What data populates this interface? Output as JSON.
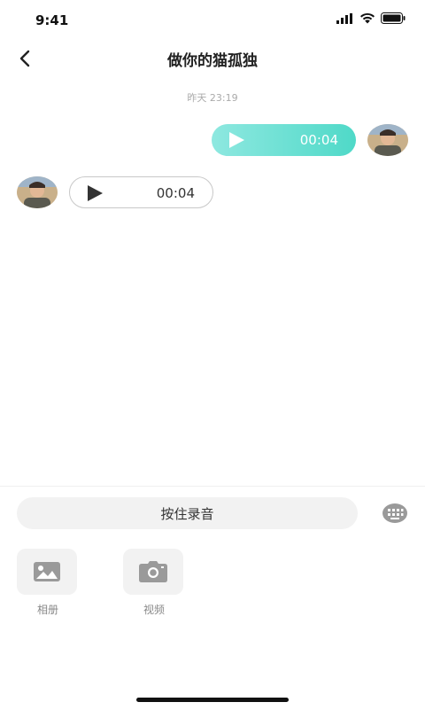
{
  "status_bar": {
    "time": "9:41"
  },
  "nav": {
    "title": "做你的猫孤独"
  },
  "chat": {
    "timestamp": "昨天 23:19",
    "messages": [
      {
        "direction": "outgoing",
        "type": "voice",
        "duration": "00:04"
      },
      {
        "direction": "incoming",
        "type": "voice",
        "duration": "00:04"
      }
    ]
  },
  "input": {
    "hold_to_talk_label": "按住录音"
  },
  "tools": [
    {
      "label": "相册",
      "icon": "image-icon"
    },
    {
      "label": "视频",
      "icon": "camera-icon"
    }
  ],
  "colors": {
    "accent_start": "#8ee8e0",
    "accent_end": "#4fd9c8"
  }
}
